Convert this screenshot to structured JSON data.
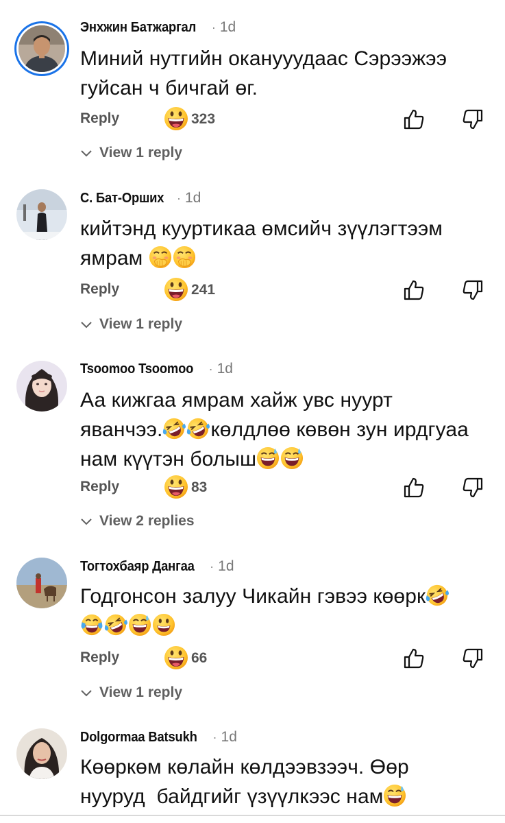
{
  "common": {
    "reply_label": "Reply"
  },
  "comments": [
    {
      "author": "Энхжин Батжаргал",
      "time": "1d",
      "text": "Миний нутгийн оканууудаас Сэрээжээ гуйсан ч бичгай өг.",
      "likes": "323",
      "replies": "View 1 reply"
    },
    {
      "author": "С. Бат-Орших",
      "time": "1d",
      "text_parts": [
        "кийтэнд кууртикаа өмсийч зүүлэгтээм",
        "ямрам"
      ],
      "likes": "241",
      "replies": "View 1 reply"
    },
    {
      "author": "Tsoomoo Tsoomoo",
      "time": "1d",
      "text_parts": [
        "Аа кижгаа ямрам хайж увс нуурт",
        "яванчээ.",
        "көлдлөө көвөн зун ирдгуаа",
        "нам күүтэн болыш"
      ],
      "likes": "83",
      "replies": "View 2 replies"
    },
    {
      "author": "Тогтохбаяр Дангаа",
      "time": "1d",
      "text": "Годгонсон залуу Чикайн гэвээ көөрк",
      "likes": "66",
      "replies": "View 1 reply"
    },
    {
      "author": "Dolgormaa Batsukh",
      "time": "1d",
      "text_parts": [
        "Көөркөм көлайн көлдээвзээч. Өөр",
        "нууруд  байдгийг үзүүлкээс нам"
      ]
    }
  ],
  "icons": {
    "like_reaction": "grinning-face-emoji",
    "thumbs_up": "thumbs-up-icon",
    "thumbs_down": "thumbs-down-icon",
    "expand": "chevron-down-icon"
  }
}
